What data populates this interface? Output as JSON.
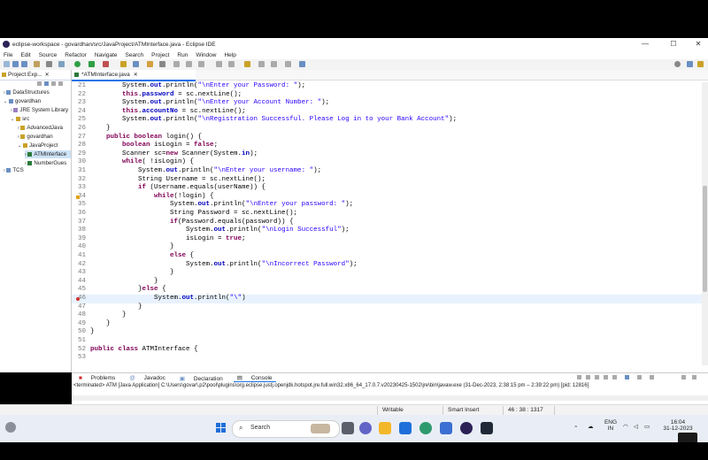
{
  "window": {
    "title": "eclipse-workspace - govardhan/src/JavaProject/ATMInterface.java - Eclipse IDE",
    "minimize": "—",
    "maximize": "☐",
    "close": "✕"
  },
  "menu": [
    "File",
    "Edit",
    "Source",
    "Refactor",
    "Navigate",
    "Search",
    "Project",
    "Run",
    "Window",
    "Help"
  ],
  "explorer": {
    "tab_label": "Project Exp...",
    "tree": [
      {
        "label": "DataStructures",
        "indent": 0
      },
      {
        "label": "govardhan",
        "indent": 0
      },
      {
        "label": "JRE System Library",
        "indent": 1
      },
      {
        "label": "src",
        "indent": 1
      },
      {
        "label": "AdvancedJava",
        "indent": 2
      },
      {
        "label": "govardhan",
        "indent": 2
      },
      {
        "label": "JavaProject",
        "indent": 2
      },
      {
        "label": "ATMInterface",
        "indent": 3
      },
      {
        "label": "NumberGues",
        "indent": 3
      },
      {
        "label": "TCS",
        "indent": 0
      }
    ]
  },
  "editor": {
    "tab_label": "*ATMInterface.java",
    "current_line": 46
  },
  "code": [
    {
      "n": "21",
      "html": "        System.<span class=\"fld\">out</span>.println(<span class=\"str\">\"\\nEnter your Password: \"</span>);"
    },
    {
      "n": "22",
      "html": "        <span class=\"kw\">this</span>.<span class=\"fld\">password</span> = sc.nextLine();"
    },
    {
      "n": "23",
      "html": "        System.<span class=\"fld\">out</span>.println(<span class=\"str\">\"\\nEnter your Account Number: \"</span>);"
    },
    {
      "n": "24",
      "html": "        <span class=\"kw\">this</span>.<span class=\"fld\">accountNo</span> = sc.nextLine();"
    },
    {
      "n": "25",
      "html": "        System.<span class=\"fld\">out</span>.println(<span class=\"str\">\"\\nRegistration Successful. Please Log in to your Bank Account\"</span>);"
    },
    {
      "n": "26",
      "html": "    }"
    },
    {
      "n": "27",
      "html": "    <span class=\"kw\">public boolean</span> login() {"
    },
    {
      "n": "28",
      "html": "        <span class=\"kw\">boolean</span> isLogin = <span class=\"kw\">false</span>;"
    },
    {
      "n": "29",
      "html": "        Scanner sc=<span class=\"kw\">new</span> Scanner(System.<span class=\"fld\">in</span>);"
    },
    {
      "n": "30",
      "html": "        <span class=\"kw\">while</span>( !isLogin) {"
    },
    {
      "n": "31",
      "html": "            System.<span class=\"fld\">out</span>.println(<span class=\"str\">\"\\nEnter your username: \"</span>);"
    },
    {
      "n": "32",
      "html": "            String Username = sc.nextLine();"
    },
    {
      "n": "33",
      "html": "            <span class=\"kw\">if</span> (Username.equals(userName)) {"
    },
    {
      "n": "34",
      "html": "                <span class=\"kw\">while</span>(!login) {"
    },
    {
      "n": "35",
      "html": "                    System.<span class=\"fld\">out</span>.println(<span class=\"str\">\"\\nEnter your password: \"</span>);"
    },
    {
      "n": "36",
      "html": "                    String Password = sc.nextLine();"
    },
    {
      "n": "37",
      "html": "                    <span class=\"kw\">if</span>(Password.equals(password)) {"
    },
    {
      "n": "38",
      "html": "                        System.<span class=\"fld\">out</span>.println(<span class=\"str\">\"\\nLogin Successful\"</span>);"
    },
    {
      "n": "39",
      "html": "                        isLogin = <span class=\"kw\">true</span>;"
    },
    {
      "n": "40",
      "html": "                    }"
    },
    {
      "n": "41",
      "html": "                    <span class=\"kw\">else</span> {"
    },
    {
      "n": "42",
      "html": "                        System.<span class=\"fld\">out</span>.println(<span class=\"str\">\"\\nIncorrect Password\"</span>);"
    },
    {
      "n": "43",
      "html": "                    }"
    },
    {
      "n": "44",
      "html": "                }"
    },
    {
      "n": "45",
      "html": "            }<span class=\"kw\">else</span> {"
    },
    {
      "n": "46",
      "html": "                System.<span class=\"fld\">out</span>.println(<span class=\"str\">\"\\\"</span>)"
    },
    {
      "n": "47",
      "html": "            }"
    },
    {
      "n": "48",
      "html": "        }"
    },
    {
      "n": "49",
      "html": "    }"
    },
    {
      "n": "50",
      "html": "}"
    },
    {
      "n": "51",
      "html": ""
    },
    {
      "n": "52",
      "html": "<span class=\"kw\">public class</span> ATMInterface {"
    },
    {
      "n": "53",
      "html": ""
    }
  ],
  "bottom_tabs": [
    "Problems",
    "Javadoc",
    "Declaration",
    "Console"
  ],
  "console": {
    "terminated": "<terminated> ATM [Java Application] C:\\Users\\govar\\.p2\\pool\\plugins\\org.eclipse.justj.openjdk.hotspot.jre.full.win32.x86_64_17.0.7.v20230425-1502\\jre\\bin\\javaw.exe  (31-Dec-2023, 2:38:15 pm – 2:39:22 pm) [pid: 12816]"
  },
  "status": {
    "writable": "Writable",
    "insert": "Smart Insert",
    "position": "46 : 38 : 1317"
  },
  "taskbar": {
    "search": "Search",
    "lang1": "ENG",
    "lang2": "IN",
    "time": "16:04",
    "date": "31-12-2023"
  }
}
